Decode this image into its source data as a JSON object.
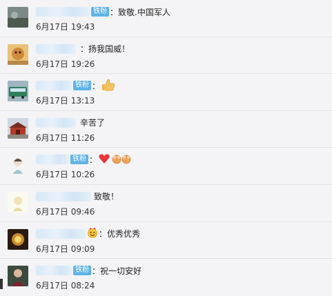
{
  "comments": [
    {
      "badge": "铁粉",
      "text": "：致敬.中国军人",
      "time": "6月17日 19:43"
    },
    {
      "badge": "",
      "text": "：扬我国威！",
      "time": "6月17日 19:26"
    },
    {
      "badge": "铁粉",
      "text": "：",
      "time": "6月17日 13:13",
      "emoji": "thumbs-up-icon"
    },
    {
      "badge": "",
      "text": "辛苦了",
      "time": "6月17日 11:26"
    },
    {
      "badge": "铁粉",
      "text": "：",
      "time": "6月17日 10:26",
      "emoji": "heart-hands-icon"
    },
    {
      "badge": "",
      "text": "致敬！",
      "time": "6月17日 09:46"
    },
    {
      "badge": "",
      "text": "：优秀优秀",
      "time": "6月17日 09:09",
      "emoji": "smile-icon"
    },
    {
      "badge": "铁粉",
      "text": "：祝一切安好",
      "time": "6月17日 08:24"
    }
  ]
}
